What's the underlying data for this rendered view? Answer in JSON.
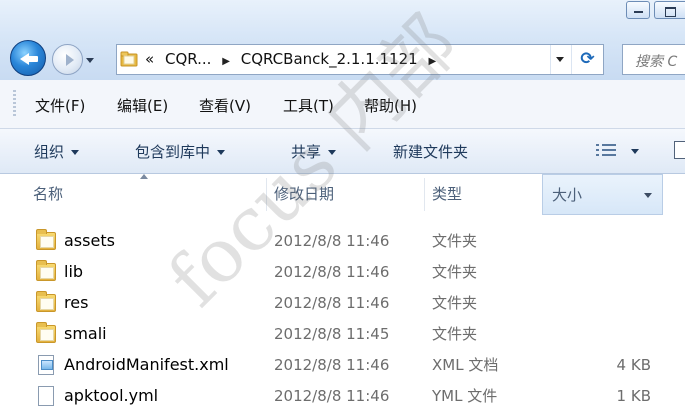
{
  "window": {
    "min_label": "",
    "max_label": ""
  },
  "address": {
    "crumbs": [
      "«",
      "CQR...",
      "CQRCBanck_2.1.1.1121"
    ],
    "refresh_glyph": "⟳"
  },
  "search": {
    "placeholder": "搜索 C"
  },
  "menu": [
    "文件(F)",
    "编辑(E)",
    "查看(V)",
    "工具(T)",
    "帮助(H)"
  ],
  "commands": {
    "organize": "组织",
    "include_library": "包含到库中",
    "share": "共享",
    "new_folder": "新建文件夹"
  },
  "columns": {
    "name": "名称",
    "date": "修改日期",
    "type": "类型",
    "size": "大小"
  },
  "files": [
    {
      "name": "assets",
      "date": "2012/8/8 11:46",
      "type": "文件夹",
      "size": "",
      "icon": "folder-icon"
    },
    {
      "name": "lib",
      "date": "2012/8/8 11:46",
      "type": "文件夹",
      "size": "",
      "icon": "folder-icon"
    },
    {
      "name": "res",
      "date": "2012/8/8 11:46",
      "type": "文件夹",
      "size": "",
      "icon": "folder-icon"
    },
    {
      "name": "smali",
      "date": "2012/8/8 11:45",
      "type": "文件夹",
      "size": "",
      "icon": "folder-icon"
    },
    {
      "name": "AndroidManifest.xml",
      "date": "2012/8/8 11:46",
      "type": "XML 文档",
      "size": "4 KB",
      "icon": "xml-file-icon"
    },
    {
      "name": "apktool.yml",
      "date": "2012/8/8 11:46",
      "type": "YML 文件",
      "size": "1 KB",
      "icon": "file-icon"
    }
  ],
  "watermark": "focus 内部"
}
